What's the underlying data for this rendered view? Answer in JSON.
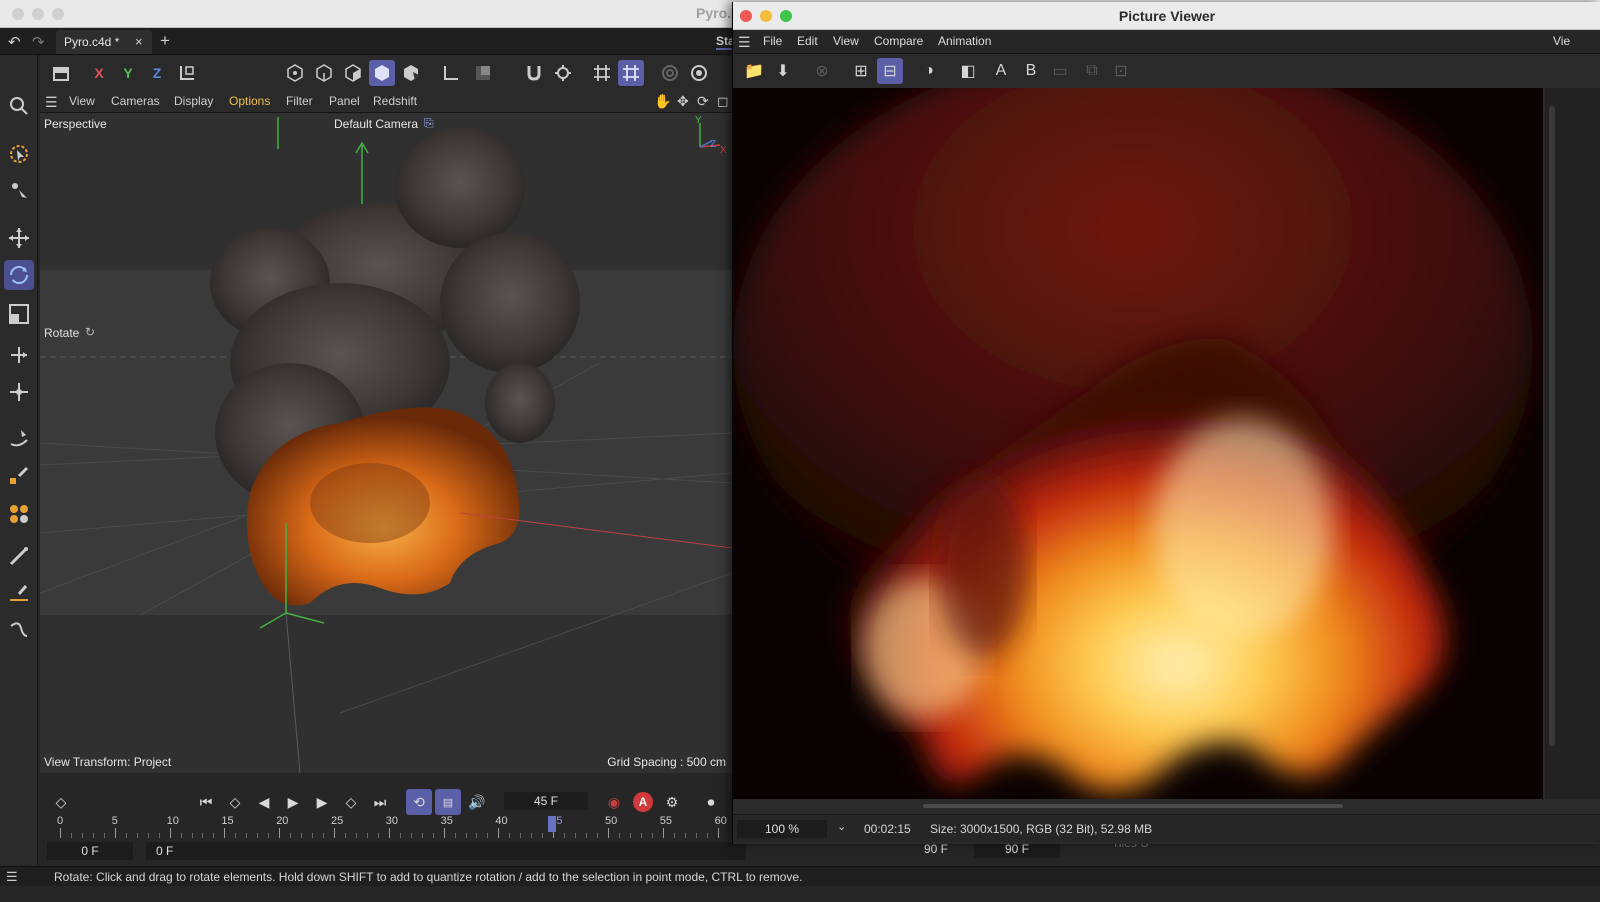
{
  "main": {
    "file_tab": "Pyro.c4d *",
    "title_partial": "Pyro.",
    "toolbar_partial": "Sta",
    "axes": [
      "X",
      "Y",
      "Z"
    ],
    "viewport_menu": [
      "View",
      "Cameras",
      "Display",
      "Options",
      "Filter",
      "Panel",
      "Redshift"
    ],
    "viewport": {
      "label": "Perspective",
      "camera": "Default Camera",
      "tool_hint": "Rotate",
      "view_transform": "View Transform: Project",
      "grid_spacing": "Grid Spacing : 500 cm",
      "axis_y": "Y",
      "axis_z": "Z",
      "axis_x": "X"
    },
    "timeline": {
      "current_frame": "45 F",
      "ruler_ticks": [
        "0",
        "5",
        "10",
        "15",
        "20",
        "25",
        "30",
        "35",
        "40",
        "45",
        "50",
        "55",
        "60"
      ],
      "start_field": "0 F",
      "min_field": "0 F",
      "end_field": "90 F",
      "max_field": "90 F",
      "auto_key": "A"
    },
    "status_bar": "Rotate: Click and drag to rotate elements. Hold down SHIFT to add to quantize rotation / add to the selection in point mode, CTRL to remove.",
    "behind_text": "Tiles U"
  },
  "picture_viewer": {
    "title": "Picture Viewer",
    "menu": [
      "File",
      "Edit",
      "View",
      "Compare",
      "Animation"
    ],
    "menu_right_partial": "Vie",
    "compare_a": "A",
    "compare_b": "B",
    "zoom": "100 %",
    "render_time": "00:02:15",
    "info": "Size: 3000x1500, RGB (32 Bit), 52.98 MB"
  },
  "colors": {
    "accent": "#5b5fa8",
    "axis_x": "#e05555",
    "axis_y": "#55c055",
    "axis_z": "#5a8ae0"
  }
}
